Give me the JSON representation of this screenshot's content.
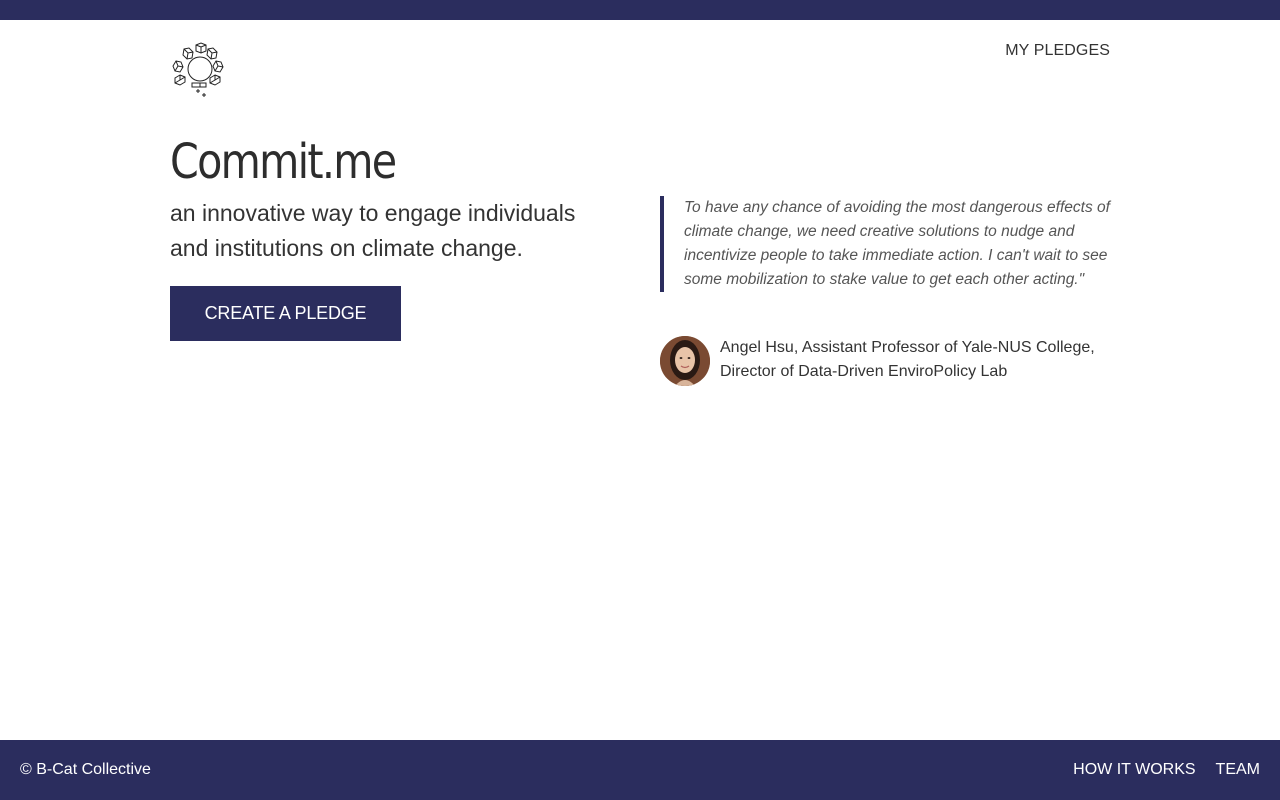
{
  "nav": {
    "logo": "logo-icon",
    "my_pledges": "MY PLEDGES"
  },
  "hero": {
    "title": "Commit.me",
    "tagline": "an innovative way to engage individuals and institutions on climate change.",
    "cta_label": "CREATE A PLEDGE"
  },
  "testimonial": {
    "quote": "To have any chance of avoiding the most dangerous effects of climate change, we need creative solutions to nudge and incentivize people to take immediate action. I can't wait to see some mobilization to stake value to get each other acting.\"",
    "author": "Angel Hsu, Assistant Professor of Yale-NUS College, Director of Data-Driven EnviroPolicy Lab",
    "avatar": "avatar-photo"
  },
  "footer": {
    "copyright": "© B-Cat Collective",
    "links": [
      "HOW IT WORKS",
      "TEAM"
    ]
  },
  "colors": {
    "brand": "#2b2d5e",
    "text": "#333333",
    "quote_text": "#555555"
  }
}
